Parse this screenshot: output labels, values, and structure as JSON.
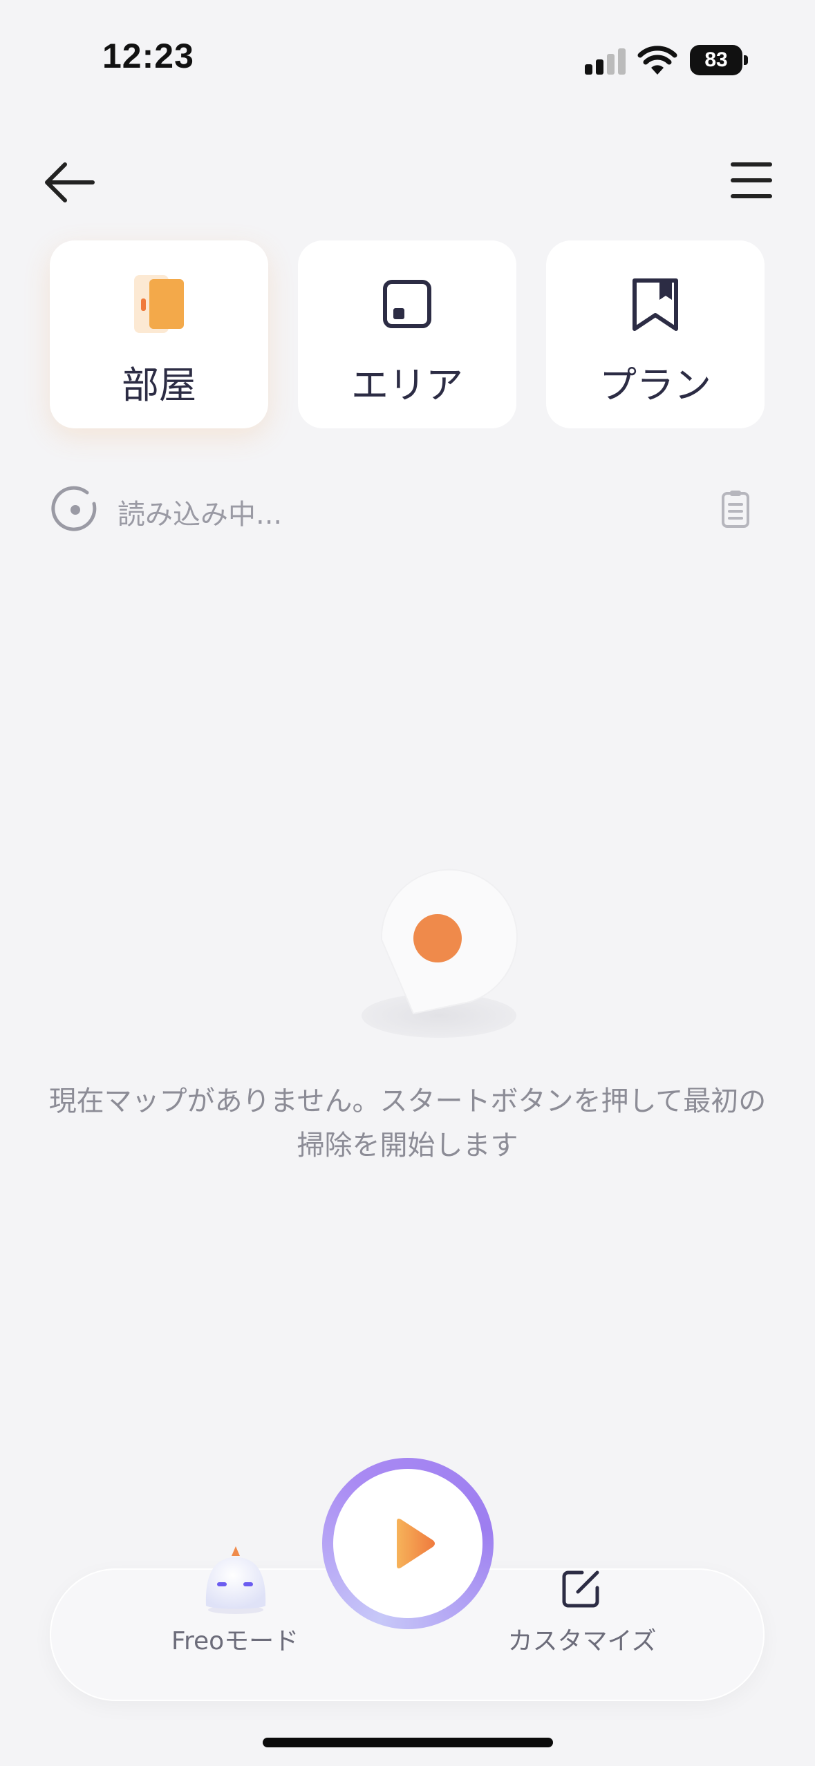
{
  "status_bar": {
    "time": "12:23",
    "battery": "83",
    "icons": [
      "cellular-signal-icon",
      "wifi-icon",
      "battery-icon"
    ]
  },
  "header": {
    "back_icon": "arrow-left-icon",
    "menu_icon": "hamburger-menu-icon"
  },
  "tabs": [
    {
      "label": "部屋",
      "icon": "door-icon",
      "active": true
    },
    {
      "label": "エリア",
      "icon": "area-square-icon",
      "active": false
    },
    {
      "label": "プラン",
      "icon": "bookmark-icon",
      "active": false
    }
  ],
  "status_row": {
    "loading_text": "読み込み中...",
    "left_icon": "radar-target-icon",
    "right_icon": "clipboard-icon"
  },
  "map": {
    "empty_message": "現在マップがありません。スタートボタンを押して最初の掃除を開始します",
    "placeholder_icon": "map-pin-icon"
  },
  "bottom_bar": {
    "freo_label": "Freoモード",
    "customize_label": "カスタマイズ",
    "start_icon": "play-icon",
    "customize_icon": "edit-icon",
    "freo_icon": "freo-robot-icon"
  },
  "colors": {
    "accent_orange": "#f0894a",
    "accent_purple": "#9d7ef0",
    "background": "#f4f4f6",
    "text_dark": "#2c2c44"
  }
}
